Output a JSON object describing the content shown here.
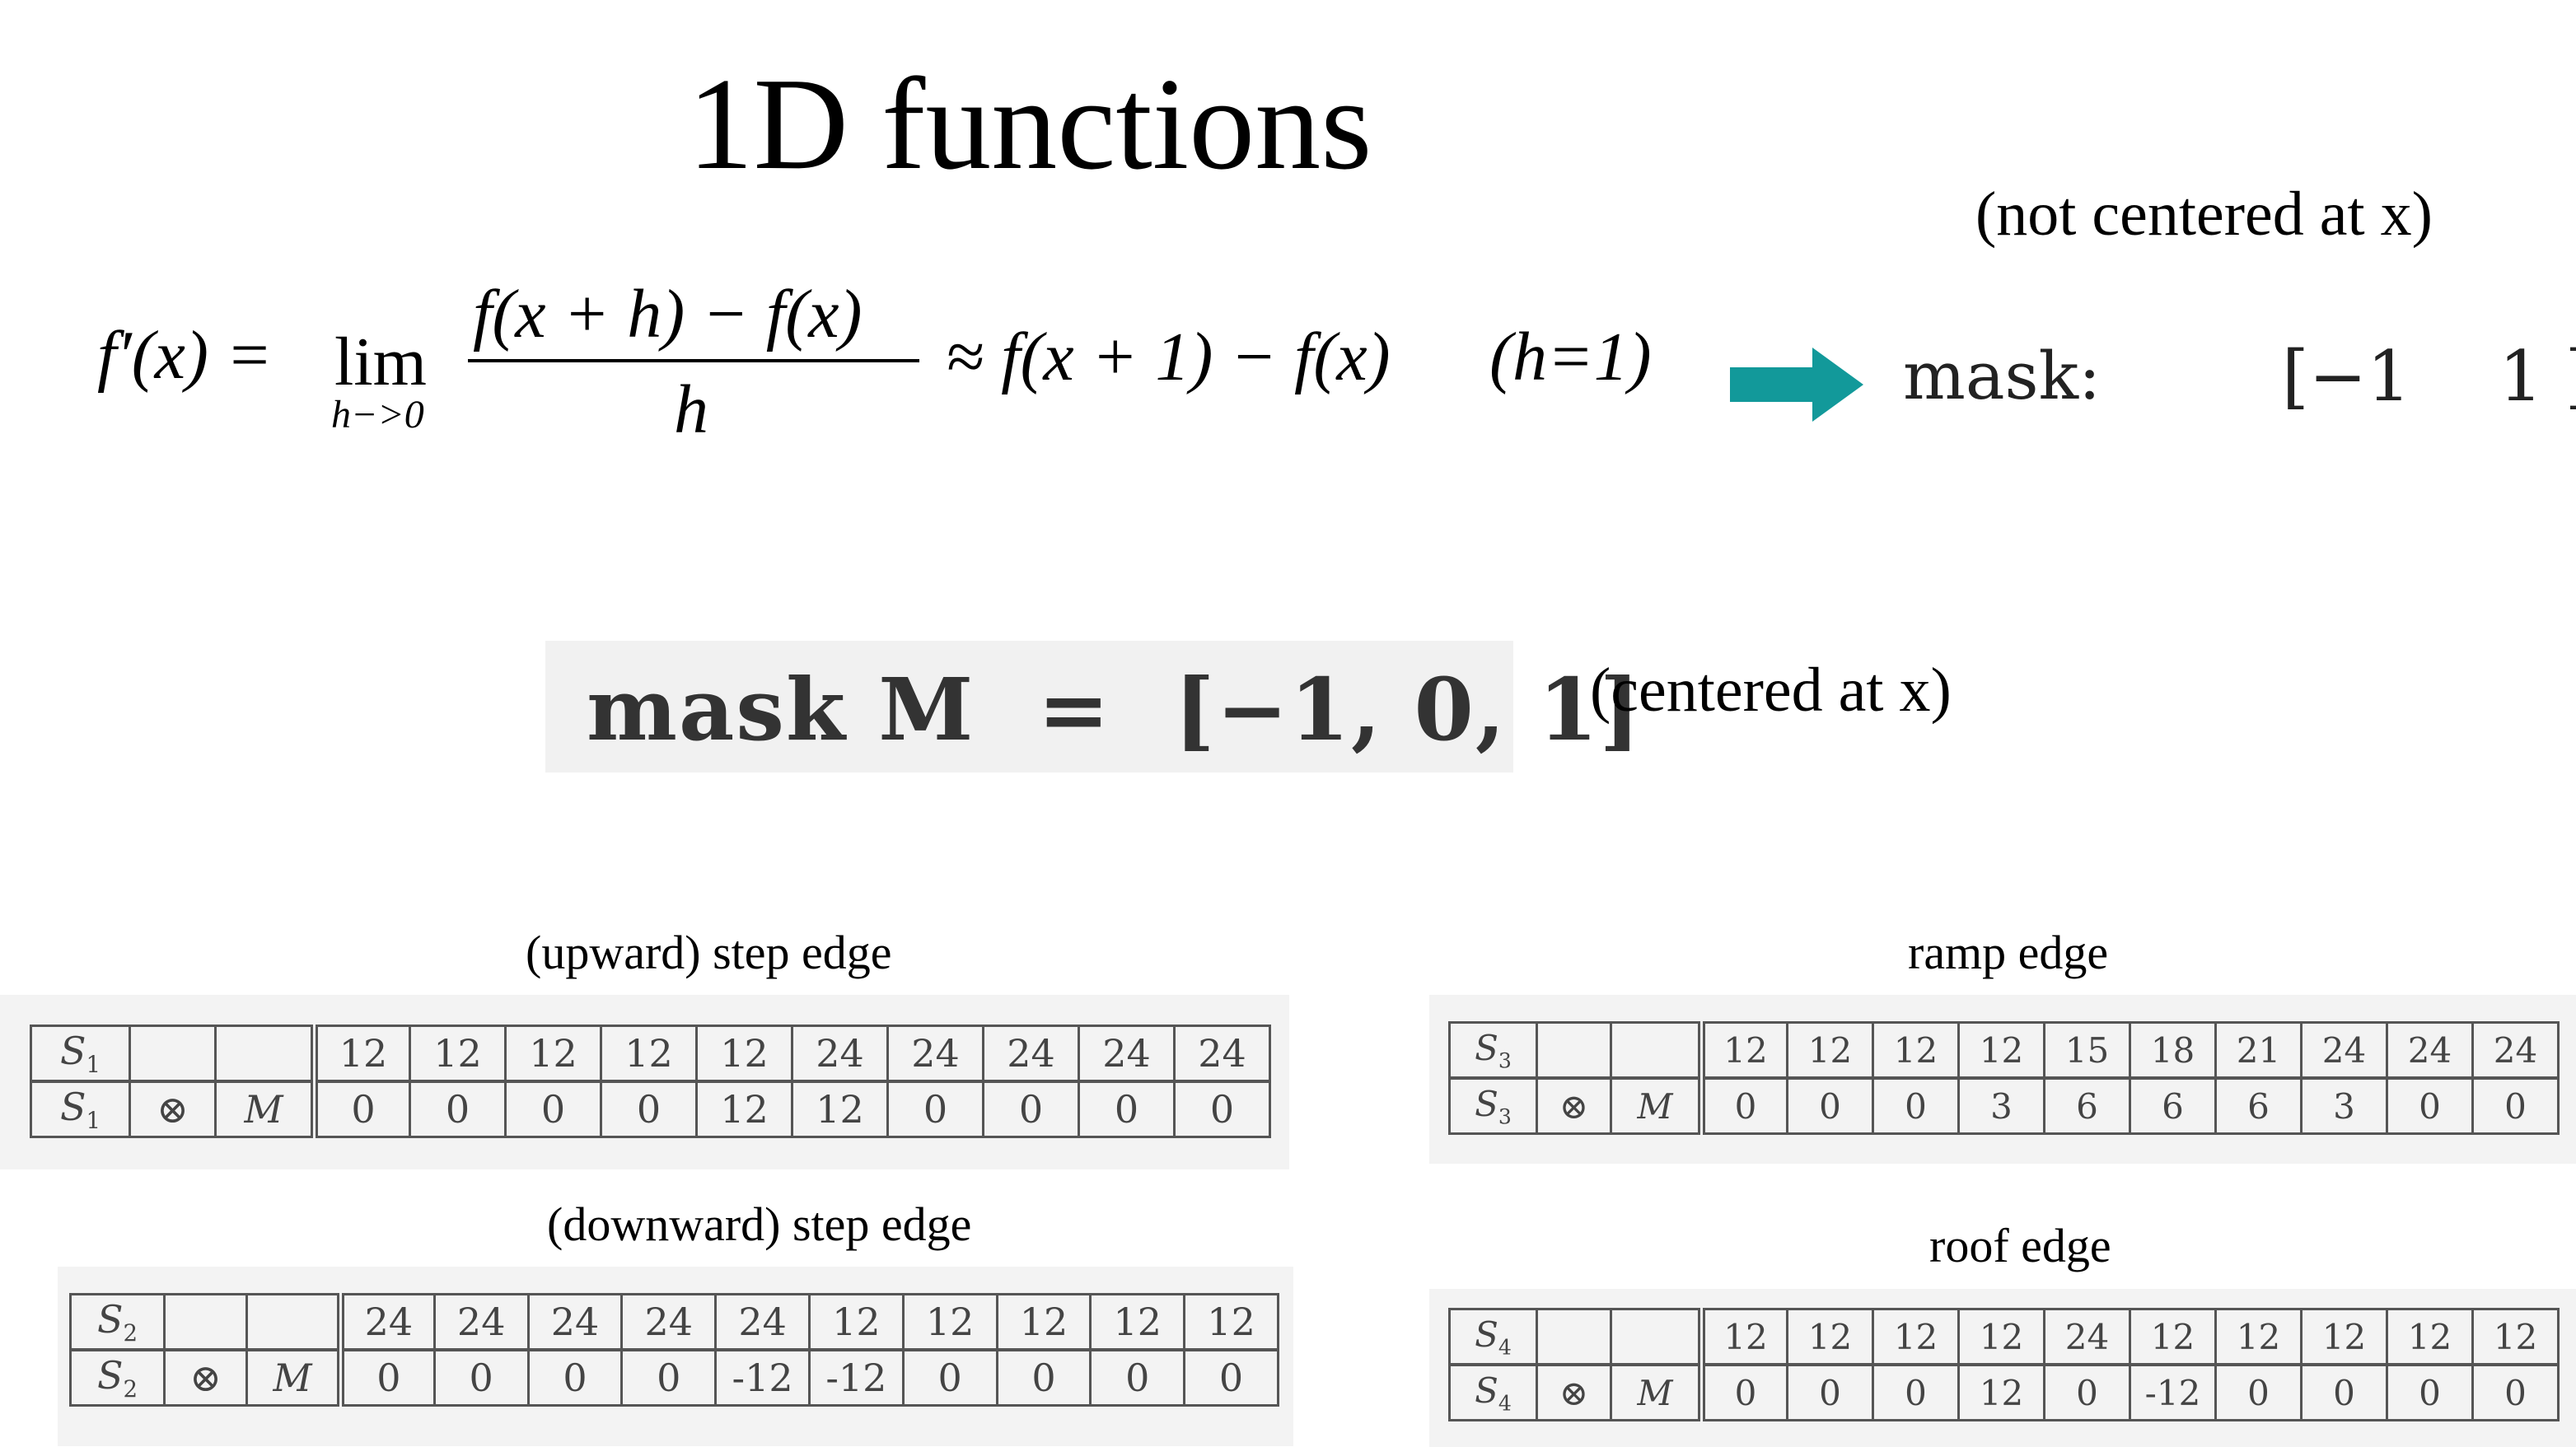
{
  "slide": {
    "title": "1D functions",
    "not_centered_note": "(not centered at x)",
    "centered_note": "(centered at x)",
    "arrow_icon": "right-arrow-icon",
    "arrow_color": "#12999a"
  },
  "formula": {
    "lhs": "f′(x) =",
    "lim": "lim",
    "lim_sub": "h−>0",
    "numerator": "f(x + h) − f(x)",
    "denominator": "h",
    "approx": "≈ f(x + 1) − f(x)",
    "h_eq": "(h=1)"
  },
  "mask": {
    "label": "mask:",
    "values": "[−1    1 ]",
    "centered_expr": "mask M  =  [−1, 0, 1]"
  },
  "tables": [
    {
      "caption": "(upward) step edge",
      "row1": {
        "label": "S",
        "sub": "1",
        "values": [
          "12",
          "12",
          "12",
          "12",
          "12",
          "24",
          "24",
          "24",
          "24",
          "24"
        ]
      },
      "row2": {
        "label": "S",
        "sub": "1",
        "op": "⊗",
        "mask": "M",
        "values": [
          "0",
          "0",
          "0",
          "0",
          "12",
          "12",
          "0",
          "0",
          "0",
          "0"
        ]
      }
    },
    {
      "caption": "(downward) step edge",
      "row1": {
        "label": "S",
        "sub": "2",
        "values": [
          "24",
          "24",
          "24",
          "24",
          "24",
          "12",
          "12",
          "12",
          "12",
          "12"
        ]
      },
      "row2": {
        "label": "S",
        "sub": "2",
        "op": "⊗",
        "mask": "M",
        "values": [
          "0",
          "0",
          "0",
          "0",
          "-12",
          "-12",
          "0",
          "0",
          "0",
          "0"
        ]
      }
    },
    {
      "caption": "ramp edge",
      "row1": {
        "label": "S",
        "sub": "3",
        "values": [
          "12",
          "12",
          "12",
          "12",
          "15",
          "18",
          "21",
          "24",
          "24",
          "24"
        ]
      },
      "row2": {
        "label": "S",
        "sub": "3",
        "op": "⊗",
        "mask": "M",
        "values": [
          "0",
          "0",
          "0",
          "3",
          "6",
          "6",
          "6",
          "3",
          "0",
          "0"
        ]
      }
    },
    {
      "caption": "roof edge",
      "row1": {
        "label": "S",
        "sub": "4",
        "values": [
          "12",
          "12",
          "12",
          "12",
          "24",
          "12",
          "12",
          "12",
          "12",
          "12"
        ]
      },
      "row2": {
        "label": "S",
        "sub": "4",
        "op": "⊗",
        "mask": "M",
        "values": [
          "0",
          "0",
          "0",
          "12",
          "0",
          "-12",
          "0",
          "0",
          "0",
          "0"
        ]
      }
    }
  ]
}
